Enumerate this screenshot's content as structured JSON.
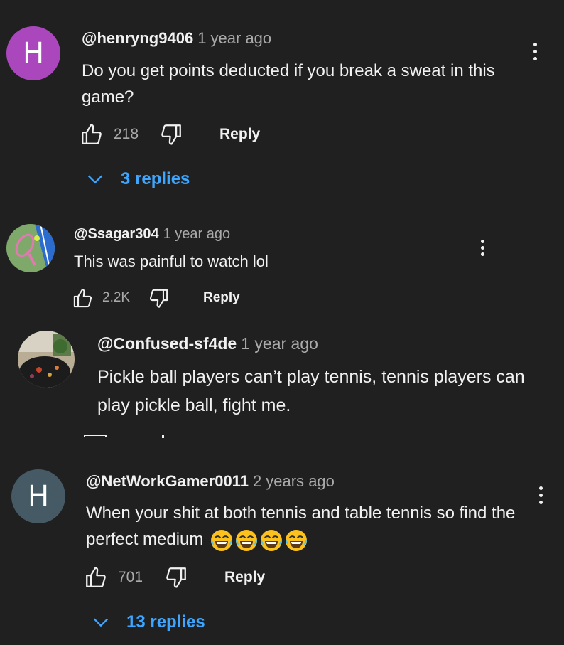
{
  "colors": {
    "background": "#202020",
    "text": "#f1f1f1",
    "secondary_text": "#aaaaaa",
    "link_blue": "#3ea6ff",
    "avatar_purple": "#ab47bc",
    "avatar_slate": "#455a64"
  },
  "comments": [
    {
      "avatar_letter": "H",
      "handle": "@henryng9406",
      "time": "1 year ago",
      "text": "Do you get points deducted if you break a sweat in this game?",
      "like_count": "218",
      "reply_label": "Reply",
      "replies_label": "3 replies"
    },
    {
      "avatar_icon": "tennis-racket-avatar",
      "handle": "@Ssagar304",
      "time": "1 year ago",
      "text": "This was painful to watch lol",
      "like_count": "2.2K",
      "reply_label": "Reply"
    },
    {
      "avatar_icon": "photo-avatar",
      "handle": "@Confused-sf4de",
      "time": "1 year ago",
      "text": "Pickle ball players can’t play tennis, tennis players can play pickle ball, fight me."
    },
    {
      "avatar_letter": "H",
      "handle": "@NetWorkGamer0011",
      "time": "2 years ago",
      "text": "When your shit at both tennis and table tennis so find the perfect medium",
      "emoji": [
        "face-with-tears-of-joy",
        "face-with-tears-of-joy",
        "face-with-tears-of-joy",
        "face-with-tears-of-joy"
      ],
      "like_count": "701",
      "reply_label": "Reply",
      "replies_label": "13 replies"
    }
  ]
}
